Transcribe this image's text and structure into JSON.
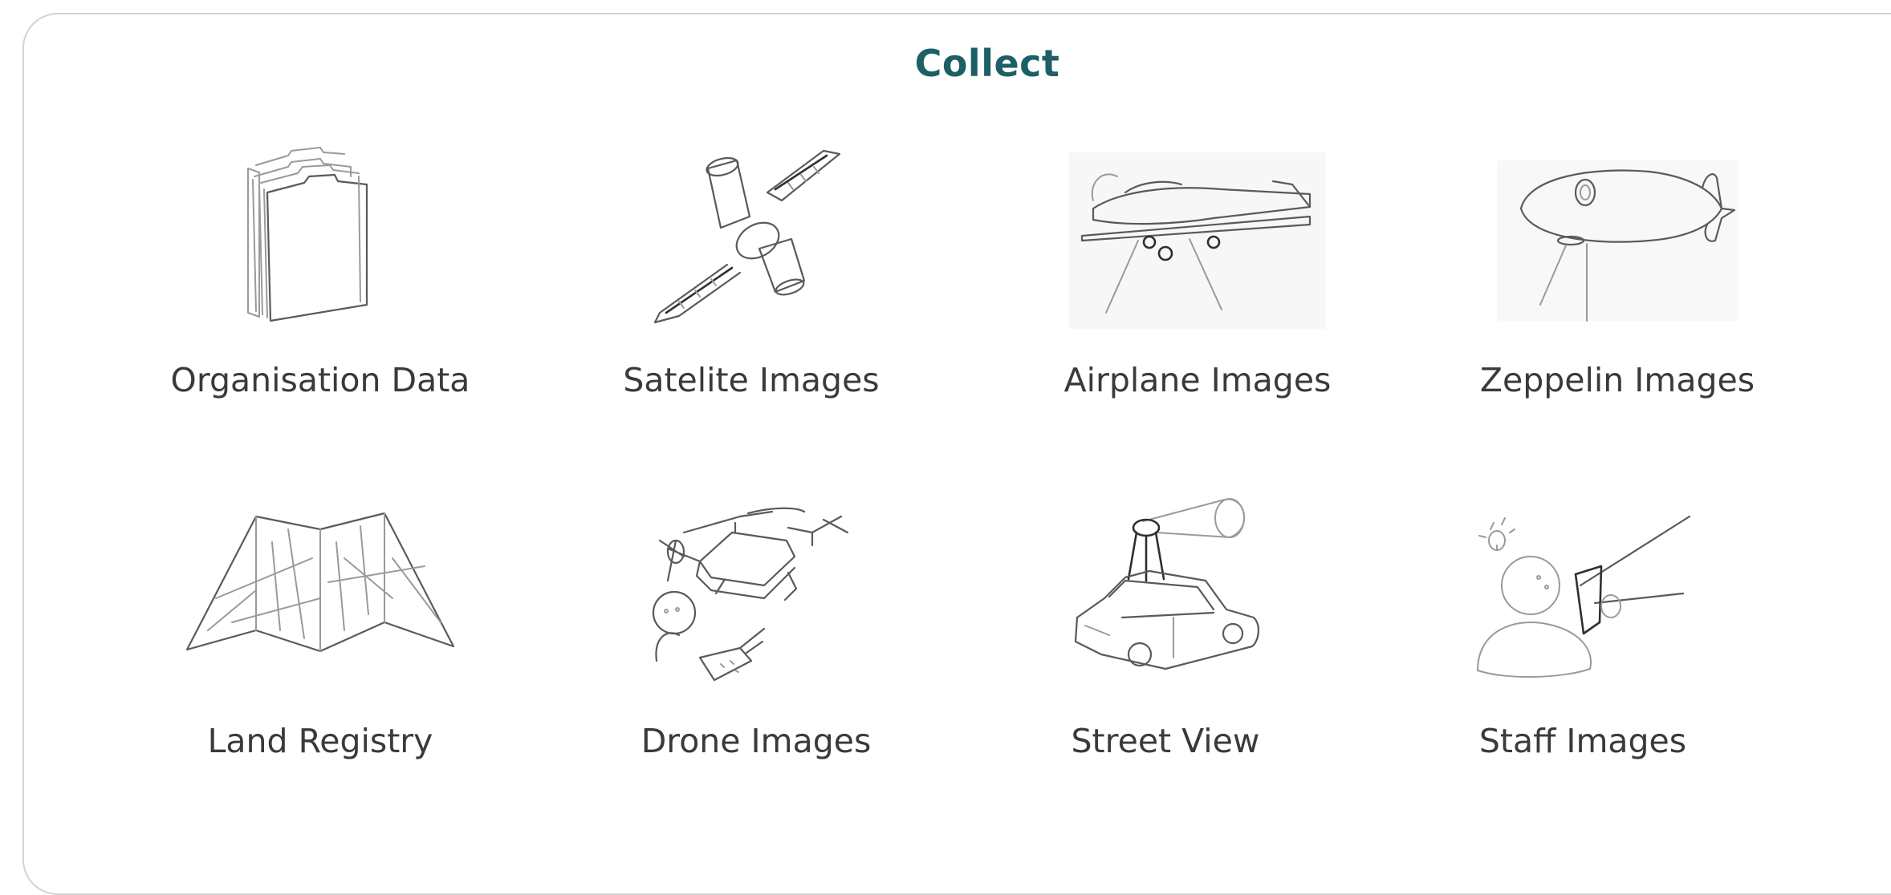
{
  "section": {
    "title": "Collect"
  },
  "items": [
    {
      "label": "Organisation Data",
      "icon": "folders-icon"
    },
    {
      "label": "Satelite Images",
      "icon": "satellite-icon"
    },
    {
      "label": "Airplane Images",
      "icon": "airplane-icon"
    },
    {
      "label": "Zeppelin Images",
      "icon": "zeppelin-icon"
    },
    {
      "label": "Land Registry",
      "icon": "folded-map-icon"
    },
    {
      "label": "Drone Images",
      "icon": "drone-icon"
    },
    {
      "label": "Street View",
      "icon": "street-view-car-icon"
    },
    {
      "label": "Staff Images",
      "icon": "staff-camera-icon"
    }
  ],
  "colors": {
    "title": "#1d5f66",
    "label": "#3a3a3a",
    "card_border": "#d3d3d3"
  }
}
